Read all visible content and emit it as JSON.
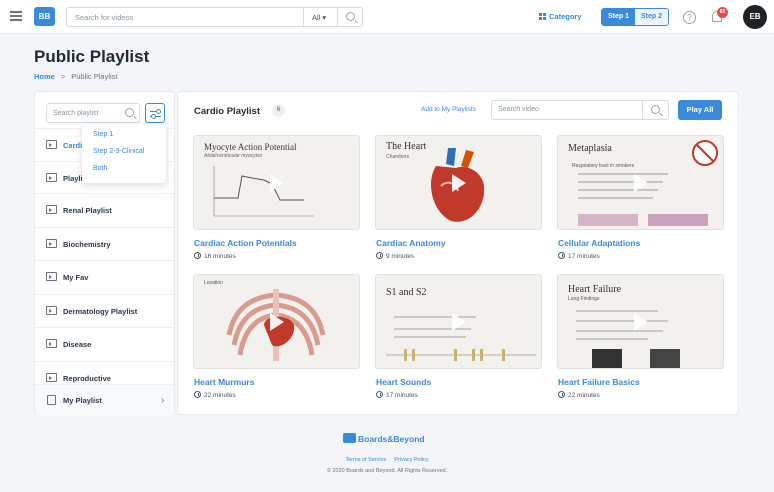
{
  "topbar": {
    "logo_text": "BB",
    "search_placeholder": "Search for videos",
    "search_scope": "All ▾",
    "category_label": "Category",
    "step1": "Step 1",
    "step2": "Step 2",
    "help_glyph": "?",
    "notification_count": "65",
    "avatar_initials": "EB"
  },
  "header": {
    "title": "Public Playlist",
    "breadcrumb_home": "Home",
    "breadcrumb_sep": ">",
    "breadcrumb_current": "Public Playlist"
  },
  "sidebar": {
    "search_placeholder": "Search playlist",
    "items": [
      {
        "label": "Cardio Playlist"
      },
      {
        "label": "Playlist"
      },
      {
        "label": "Renal Playlist"
      },
      {
        "label": "Biochemistry"
      },
      {
        "label": "My Fav"
      },
      {
        "label": "Dermatology Playlist"
      },
      {
        "label": "Disease"
      },
      {
        "label": "Reproductive"
      }
    ],
    "my_playlist": "My Playlist",
    "chevron": "›",
    "filter_options": [
      "Step 1",
      "Step 2-3-Clinical",
      "Both"
    ]
  },
  "main": {
    "title": "Cardio Playlist",
    "count": "6",
    "add_link": "Add to My Playlists",
    "search_placeholder": "Search video",
    "play_all": "Play All",
    "videos": [
      {
        "title": "Cardiac Action Potentials",
        "duration": "16 minutes",
        "thumb_title": "Myocyte Action Potential",
        "thumb_sub": "Atrial/ventricular myocytes"
      },
      {
        "title": "Cardiac Anatomy",
        "duration": "9 minutes",
        "thumb_title": "The Heart",
        "thumb_sub": "Chambers"
      },
      {
        "title": "Cellular Adaptations",
        "duration": "17 minutes",
        "thumb_title": "Metaplasia",
        "thumb_sub": "Respiratory tract in smokers"
      },
      {
        "title": "Heart Murmurs",
        "duration": "22 minutes",
        "thumb_title": "Location",
        "thumb_sub": ""
      },
      {
        "title": "Heart Sounds",
        "duration": "17 minutes",
        "thumb_title": "S1 and S2",
        "thumb_sub": ""
      },
      {
        "title": "Heart Failure Basics",
        "duration": "22 minutes",
        "thumb_title": "Heart Failure",
        "thumb_sub": "Lung Findings"
      }
    ]
  },
  "footer": {
    "brand": "Boards&Beyond",
    "terms": "Terms of Service",
    "privacy": "Privacy Policy",
    "copyright": "© 2020 Boards and Beyond. All Rights Reserved."
  },
  "colors": {
    "accent": "#3b8ad9",
    "badge": "#e5484d",
    "avatar": "#1f2328"
  }
}
